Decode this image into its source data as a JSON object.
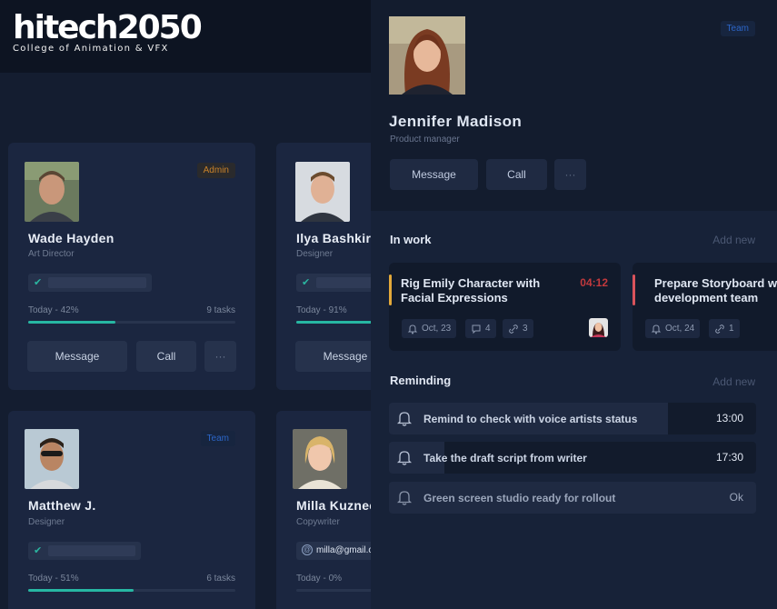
{
  "logo": {
    "word": "hitech2050",
    "tagline": "College of Animation & VFX"
  },
  "cards": [
    {
      "name": "Wade Hayden",
      "role": "Art Director",
      "badge": "Admin",
      "progress_label": "Today - 42%",
      "progress": 42,
      "tasks": "9 tasks",
      "message": "Message",
      "call": "Call",
      "more": "···"
    },
    {
      "name": "Ilya Bashkirov",
      "role": "Designer",
      "progress_label": "Today - 91%",
      "progress": 91,
      "message": "Message"
    },
    {
      "name": "Matthew J.",
      "role": "Designer",
      "badge": "Team",
      "progress_label": "Today - 51%",
      "progress": 51,
      "tasks": "6 tasks"
    },
    {
      "name": "Milla Kuznecova",
      "role": "Copywriter",
      "email": "milla@gmail.com",
      "progress_label": "Today - 0%",
      "progress": 0
    }
  ],
  "profile": {
    "name": "Jennifer Madison",
    "role": "Product manager",
    "badge": "Team",
    "message": "Message",
    "call": "Call",
    "more": "···"
  },
  "in_work": {
    "title": "In work",
    "add": "Add new",
    "tasks": [
      {
        "title": "Rig Emily Character with Facial Expressions",
        "time": "04:12",
        "date": "Oct, 23",
        "comments": "4",
        "links": "3",
        "accent": "#e3a93a"
      },
      {
        "title": "Prepare Storyboard with development team",
        "date": "Oct, 24",
        "links": "1",
        "accent": "#d9535b"
      }
    ]
  },
  "reminding": {
    "title": "Reminding",
    "add": "Add new",
    "items": [
      {
        "text": "Remind to check with voice artists status",
        "time": "13:00",
        "remaining": 0.24
      },
      {
        "text": "Take the draft script from writer",
        "time": "17:30",
        "remaining": 0.85
      },
      {
        "text": "Green screen studio ready for rollout",
        "time": "Ok",
        "remaining": 0
      }
    ]
  }
}
